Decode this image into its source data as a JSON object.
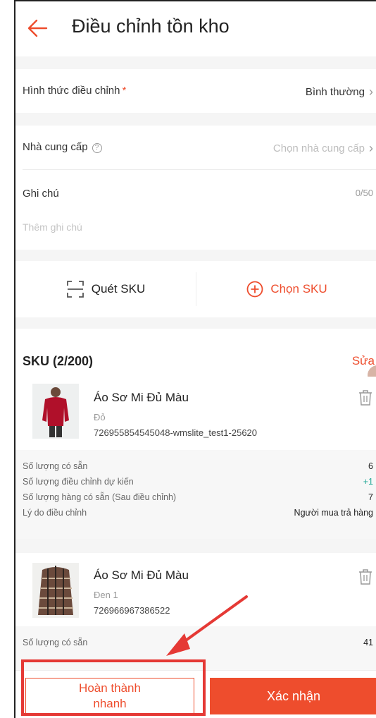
{
  "header": {
    "title": "Điều chỉnh tồn kho",
    "back_icon": "arrow-left-icon"
  },
  "form": {
    "adjust_type": {
      "label": "Hình thức điều chỉnh",
      "required_mark": "*",
      "value": "Bình thường"
    },
    "supplier": {
      "label": "Nhà cung cấp",
      "help_icon": "question-circle-icon",
      "placeholder": "Chọn nhà cung cấp"
    },
    "note": {
      "label": "Ghi chú",
      "counter": "0/50",
      "placeholder": "Thêm ghi chú"
    }
  },
  "actions": {
    "scan_label": "Quét SKU",
    "choose_label": "Chọn SKU"
  },
  "sku_section": {
    "title": "SKU (2/200)",
    "edit_label": "Sửa"
  },
  "items": [
    {
      "name": "Áo Sơ Mi Đủ Màu",
      "variant": "Đỏ",
      "sku": "726955854545048-wmslite_test1-25620",
      "stats": [
        {
          "label": "Số lượng có sẵn",
          "value": "6"
        },
        {
          "label": "Số lượng điều chỉnh dự kiến",
          "value": "+1"
        },
        {
          "label": "Số lượng hàng có sẵn (Sau điều chỉnh)",
          "value": "7"
        },
        {
          "label": "Lý do điều chỉnh",
          "value": "Người mua trả hàng"
        }
      ]
    },
    {
      "name": "Áo Sơ Mi Đủ Màu",
      "variant": "Đen 1",
      "sku": "726966967386522",
      "stats": [
        {
          "label": "Số lượng có sẵn",
          "value": "41"
        }
      ]
    }
  ],
  "bottom": {
    "quick_line1": "Hoàn thành",
    "quick_line2": "nhanh",
    "confirm_label": "Xác nhận"
  },
  "colors": {
    "accent": "#ee4d2d",
    "green": "#26aa99",
    "annotation": "#e53935"
  }
}
